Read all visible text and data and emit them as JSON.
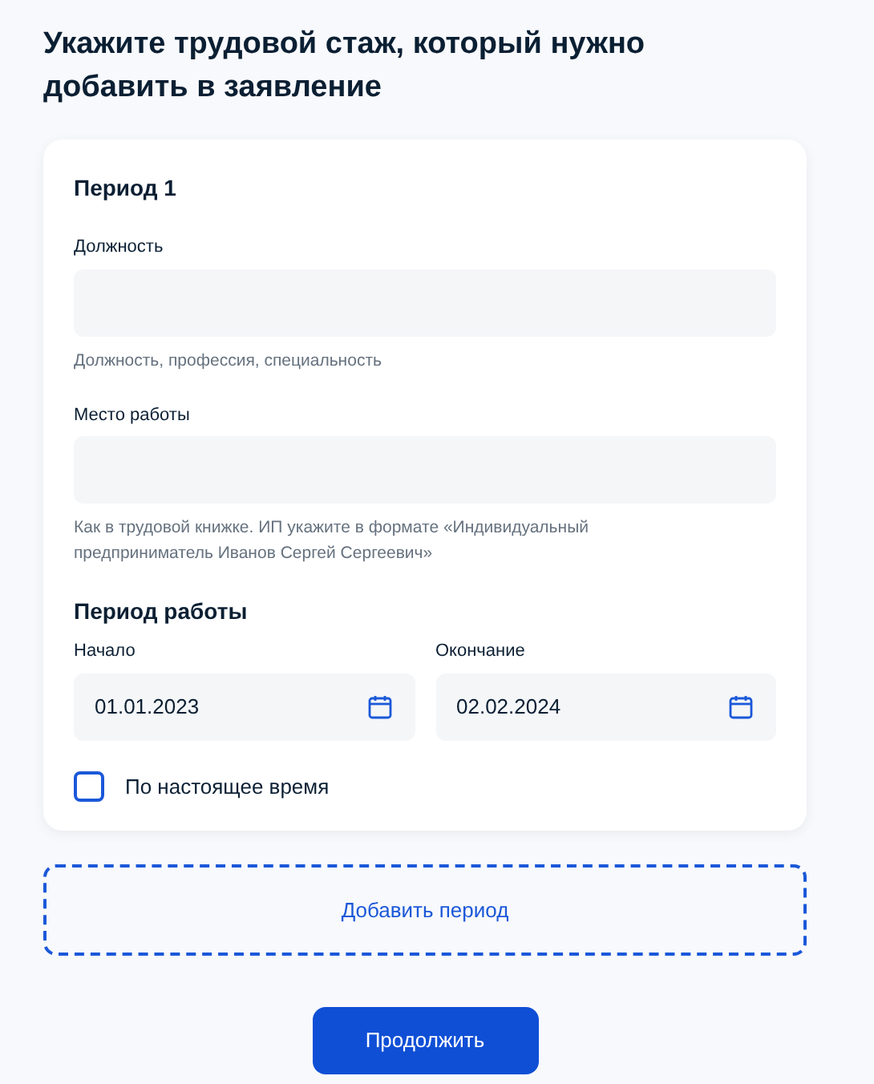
{
  "title": "Укажите трудовой стаж, который нужно добавить в заявление",
  "period": {
    "heading": "Период 1",
    "fields": [
      {
        "label": "Должность",
        "hint": "Должность, профессия, специальность"
      },
      {
        "label": "Место работы",
        "hint": "Как в трудовой книжке. ИП укажите в формате «Индивидуальный предприниматель Иванов Сергей Сергеевич»"
      }
    ],
    "work_period": {
      "heading": "Период работы",
      "dates": [
        {
          "label": "Начало",
          "value": "01.01.2023"
        },
        {
          "label": "Окончание",
          "value": "02.02.2024"
        }
      ]
    },
    "current": {
      "label": "По настоящее время",
      "checked": false
    }
  },
  "add_button": "Добавить период",
  "continue_button": "Продолжить"
}
